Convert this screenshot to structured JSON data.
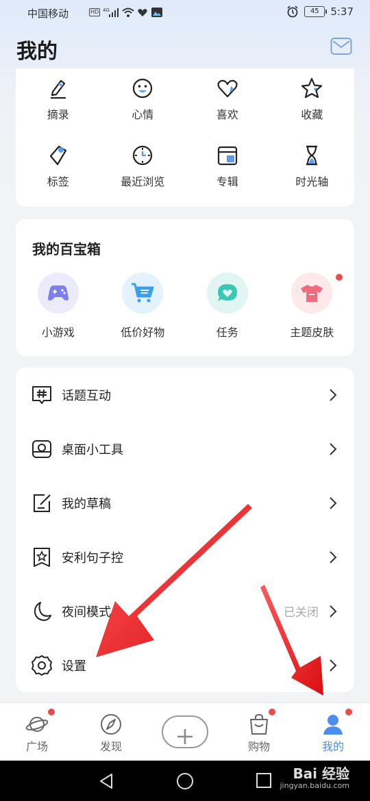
{
  "status_bar": {
    "carrier": "中国移动",
    "signal_label": "4G",
    "hd_label": "HD",
    "battery": "45",
    "time": "5:37"
  },
  "header": {
    "title": "我的",
    "mail_icon": "mail-icon"
  },
  "quick_actions": [
    {
      "label": "摘录",
      "icon": "pen-icon"
    },
    {
      "label": "心情",
      "icon": "smiley-icon"
    },
    {
      "label": "喜欢",
      "icon": "heart-icon"
    },
    {
      "label": "收藏",
      "icon": "star-icon"
    },
    {
      "label": "标签",
      "icon": "tag-icon"
    },
    {
      "label": "最近浏览",
      "icon": "clock-icon"
    },
    {
      "label": "专辑",
      "icon": "album-icon"
    },
    {
      "label": "时光轴",
      "icon": "hourglass-icon"
    }
  ],
  "toolbox": {
    "title": "我的百宝箱",
    "items": [
      {
        "label": "小游戏",
        "icon": "gamepad-icon",
        "color": "#7b7ff0"
      },
      {
        "label": "低价好物",
        "icon": "cart-icon",
        "color": "#3aa0f0"
      },
      {
        "label": "任务",
        "icon": "chat-heart-icon",
        "color": "#3cc6b4"
      },
      {
        "label": "主题皮肤",
        "icon": "tshirt-icon",
        "color": "#f06b7d"
      }
    ]
  },
  "menu": [
    {
      "label": "话题互动",
      "icon": "hashtag-icon",
      "value": ""
    },
    {
      "label": "桌面小工具",
      "icon": "widget-icon",
      "value": ""
    },
    {
      "label": "我的草稿",
      "icon": "draft-icon",
      "value": ""
    },
    {
      "label": "安利句子控",
      "icon": "bookmark-star-icon",
      "value": ""
    },
    {
      "label": "夜间模式",
      "icon": "moon-icon",
      "value": "已关闭"
    },
    {
      "label": "设置",
      "icon": "gear-icon",
      "value": ""
    }
  ],
  "bottom_nav": [
    {
      "label": "广场",
      "icon": "planet-icon"
    },
    {
      "label": "发现",
      "icon": "compass-icon"
    },
    {
      "label": "",
      "icon": "plus-icon"
    },
    {
      "label": "购物",
      "icon": "bag-icon"
    },
    {
      "label": "我的",
      "icon": "person-icon"
    }
  ],
  "watermark": {
    "brand": "Bai 经验",
    "url": "jingyan.baidu.com"
  },
  "colors": {
    "accent": "#4c8df0",
    "badge": "#ec4b4b",
    "arrow": "#e8161b"
  }
}
